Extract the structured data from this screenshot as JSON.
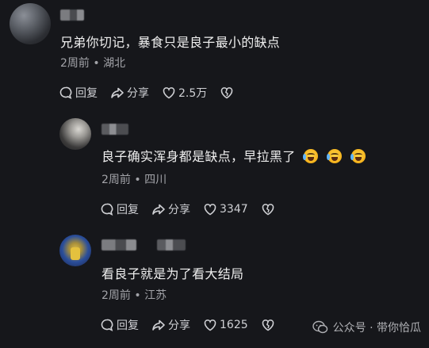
{
  "comments": [
    {
      "text": "兄弟你切记，暴食只是良子最小的缺点",
      "meta": "2周前 • 湖北",
      "reply": "回复",
      "share": "分享",
      "likes": "2.5万"
    },
    {
      "text": "良子确实浑身都是缺点，早拉黑了",
      "emojis": [
        "crying-laughing-emoji",
        "crying-laughing-emoji",
        "crying-laughing-emoji"
      ],
      "meta": "2周前 • 四川",
      "reply": "回复",
      "share": "分享",
      "likes": "3347"
    },
    {
      "text": "看良子就是为了看大结局",
      "meta": "2周前 • 江苏",
      "reply": "回复",
      "share": "分享",
      "likes": "1625"
    }
  ],
  "watermark": {
    "label": "公众号 · 带你恰瓜",
    "icon": "wechat-official-account-icon"
  },
  "colors": {
    "background": "#16171b",
    "text": "#efefef",
    "meta": "#a2a3a8"
  }
}
